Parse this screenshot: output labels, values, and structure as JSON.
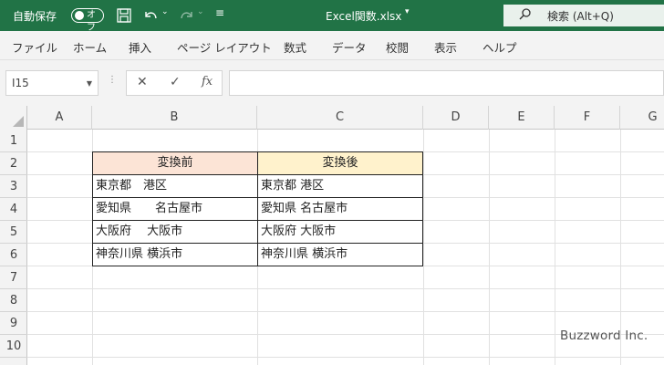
{
  "titlebar": {
    "autosave_label": "自動保存",
    "autosave_state": "オフ",
    "filename": "Excel関数.xlsx",
    "search_text": "検索 (Alt+Q)"
  },
  "ribbon": {
    "tabs": [
      "ファイル",
      "ホーム",
      "挿入",
      "ページ レイアウト",
      "数式",
      "データ",
      "校閲",
      "表示",
      "ヘルプ"
    ]
  },
  "formula_bar": {
    "name_box": "I15",
    "fx_label": "fx",
    "value": ""
  },
  "sheet": {
    "columns": [
      "A",
      "B",
      "C",
      "D",
      "E",
      "F",
      "G"
    ],
    "rows": [
      "1",
      "2",
      "3",
      "4",
      "5",
      "6",
      "7",
      "8",
      "9",
      "10"
    ],
    "table": {
      "header_before": "変換前",
      "header_after": "変換後",
      "header_before_color": "#fce4d6",
      "header_after_color": "#fff2cc",
      "before": [
        "東京都　港区",
        "愛知県　　名古屋市",
        "大阪府　 大阪市",
        "神奈川県 横浜市"
      ],
      "after": [
        "東京都 港区",
        "愛知県 名古屋市",
        "大阪府 大阪市",
        "神奈川県 横浜市"
      ]
    }
  },
  "watermark": "Buzzword Inc."
}
